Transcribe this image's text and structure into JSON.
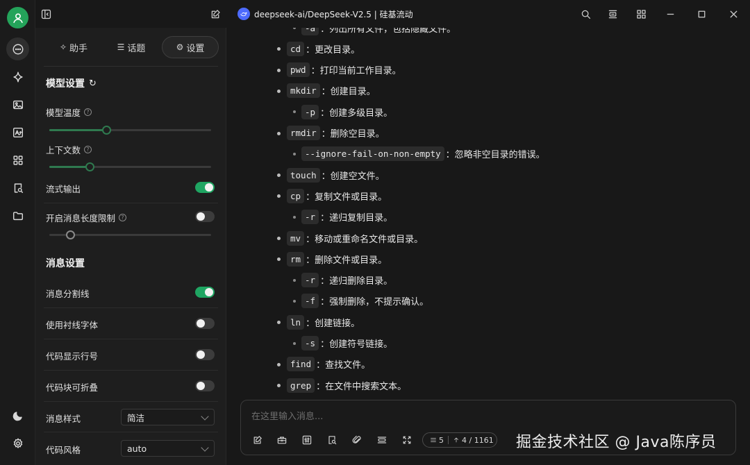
{
  "titlebar": {
    "title": "deepseek-ai/DeepSeek-V2.5 | 硅基流动"
  },
  "tabs": [
    {
      "label": "助手",
      "icon": "sparkle-icon"
    },
    {
      "label": "话题",
      "icon": "list-icon"
    },
    {
      "label": "设置",
      "icon": "gear-icon",
      "active": true
    }
  ],
  "model_settings": {
    "title": "模型设置",
    "temperature": {
      "label": "模型温度",
      "value_fraction": 0.35
    },
    "context": {
      "label": "上下文数",
      "value_fraction": 0.25
    },
    "stream_output": {
      "label": "流式输出",
      "on": true
    },
    "length_limit": {
      "label": "开启消息长度限制",
      "on": false,
      "slider_fraction": 0.13
    }
  },
  "message_settings": {
    "title": "消息设置",
    "divider": {
      "label": "消息分割线",
      "on": true
    },
    "serif_font": {
      "label": "使用衬线字体",
      "on": false
    },
    "line_numbers": {
      "label": "代码显示行号",
      "on": false
    },
    "collapsible": {
      "label": "代码块可折叠",
      "on": false
    },
    "message_style": {
      "label": "消息样式",
      "value": "简洁"
    },
    "code_style": {
      "label": "代码风格",
      "value": "auto"
    }
  },
  "chat_items": [
    {
      "level": 2,
      "code": "-a",
      "text": "：列出所有文件，包括隐藏文件。"
    },
    {
      "level": 1,
      "code": "cd",
      "text": "：更改目录。"
    },
    {
      "level": 1,
      "code": "pwd",
      "text": "：打印当前工作目录。"
    },
    {
      "level": 1,
      "code": "mkdir",
      "text": "：创建目录。"
    },
    {
      "level": 2,
      "code": "-p",
      "text": "：创建多级目录。"
    },
    {
      "level": 1,
      "code": "rmdir",
      "text": "：删除空目录。"
    },
    {
      "level": 2,
      "code": "--ignore-fail-on-non-empty",
      "text": "：忽略非空目录的错误。"
    },
    {
      "level": 1,
      "code": "touch",
      "text": "：创建空文件。"
    },
    {
      "level": 1,
      "code": "cp",
      "text": "：复制文件或目录。"
    },
    {
      "level": 2,
      "code": "-r",
      "text": "：递归复制目录。"
    },
    {
      "level": 1,
      "code": "mv",
      "text": "：移动或重命名文件或目录。"
    },
    {
      "level": 1,
      "code": "rm",
      "text": "：删除文件或目录。"
    },
    {
      "level": 2,
      "code": "-r",
      "text": "：递归删除目录。"
    },
    {
      "level": 2,
      "code": "-f",
      "text": "：强制删除，不提示确认。"
    },
    {
      "level": 1,
      "code": "ln",
      "text": "：创建链接。"
    },
    {
      "level": 2,
      "code": "-s",
      "text": "：创建符号链接。"
    },
    {
      "level": 1,
      "code": "find",
      "text": "：查找文件。"
    },
    {
      "level": 1,
      "code": "grep",
      "text": "：在文件中搜索文本。"
    }
  ],
  "input": {
    "placeholder": "在这里输入消息...",
    "context_count": "5",
    "token_count": "4 / 1161"
  },
  "watermark": "掘金技术社区 @ Java陈序员"
}
